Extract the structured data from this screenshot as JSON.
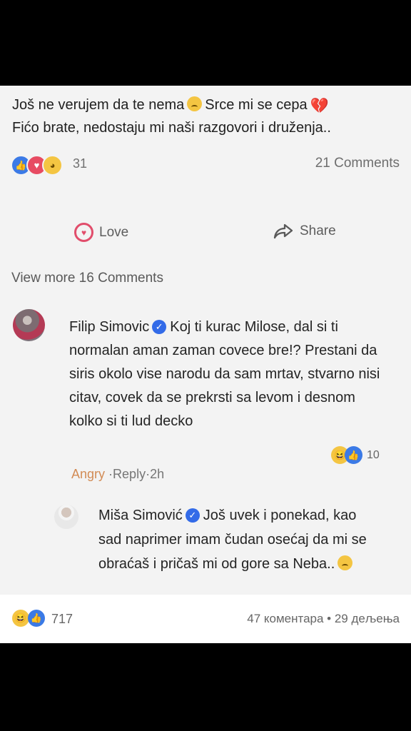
{
  "post": {
    "line1_before": "Još ne verujem da te nema",
    "line1_after": "Srce mi se cepa",
    "line2": "Fićo brate, nedostaju mi naši razgovori i druženja.."
  },
  "reactions": {
    "count": "31",
    "comments": "21 Comments"
  },
  "actions": {
    "love": "Love",
    "share": "Share"
  },
  "view_more": "View more 16 Comments",
  "comment1": {
    "author": "Filip Simovic",
    "text": "Koj ti kurac Milose, dal si ti normalan aman zaman covece bre!? Prestani da siris okolo vise narodu da sam mrtav, stvarno nisi citav, covek da se prekrsti sa levom i desnom kolko si ti lud decko",
    "reaction_count": "10",
    "angry": "Angry",
    "separator": "·",
    "reply": "Reply",
    "time": "2h"
  },
  "reply": {
    "author": "Miša Simović",
    "text": "Još uvek i ponekad, kao sad naprimer imam čudan osećaj da mi se obraćaš i pričaš mi od gore sa Neba.."
  },
  "bottom": {
    "reaction_count": "717",
    "stats": "47 коментара • 29 дељења"
  },
  "colors": {
    "like": "#3b7ae6",
    "love": "#e74b62",
    "verified": "#336be8",
    "background": "#f3f3f3"
  }
}
